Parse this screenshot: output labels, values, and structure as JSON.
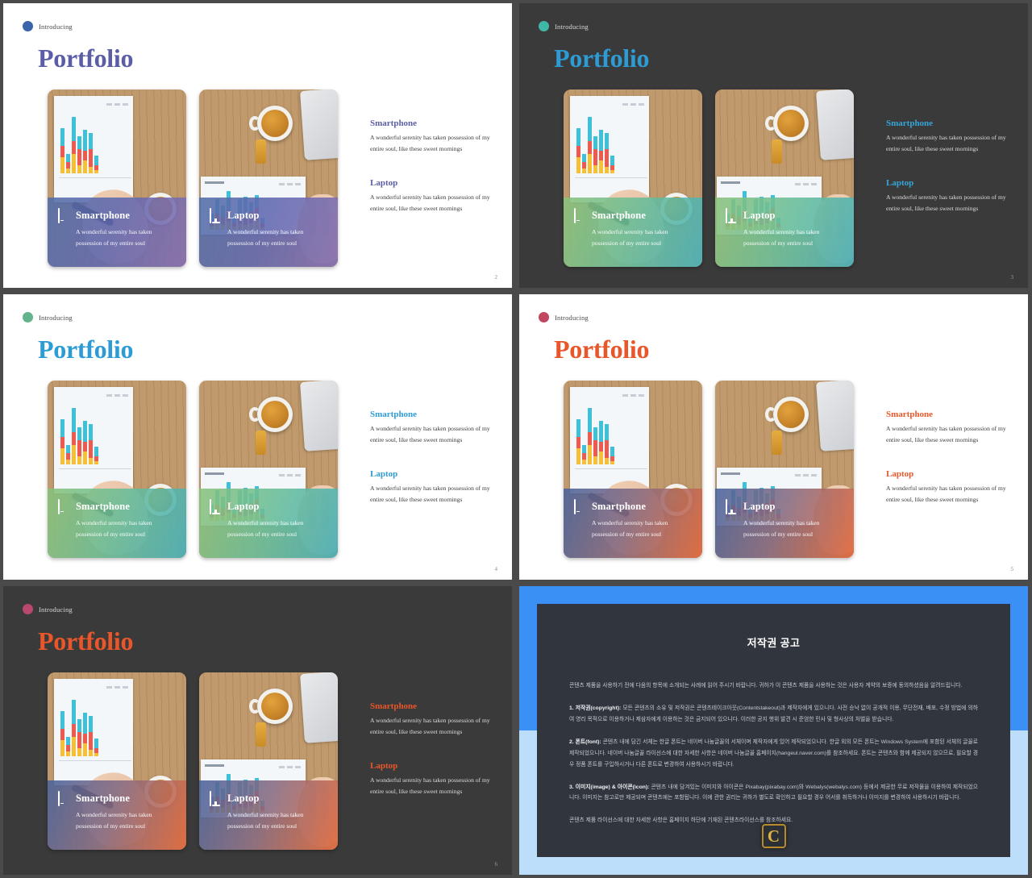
{
  "slides": [
    {
      "theme": "light",
      "dot_color": "#3c64ab",
      "eyebrow": "Introducing",
      "title": "Portfolio",
      "title_color": "#5b5ea6",
      "accent": "#5b5ea6",
      "overlay": "linear-gradient(110deg, rgba(82,110,168,0.88) 0%, rgba(96,104,176,0.88) 45%, rgba(132,110,176,0.88) 100%)",
      "cards": [
        {
          "icon": "phone-icon",
          "title": "Smartphone",
          "body": "A wonderful serenity has taken possession of my entire soul"
        },
        {
          "icon": "monitor-icon",
          "title": "Laptop",
          "body": "A wonderful serenity has taken possession of my entire soul"
        }
      ],
      "features": [
        {
          "heading": "Smartphone",
          "body": "A wonderful serenity has taken possession of my entire soul, like these sweet mornings"
        },
        {
          "heading": "Laptop",
          "body": "A wonderful serenity has taken possession of my entire soul, like these sweet mornings"
        }
      ],
      "page": "2"
    },
    {
      "theme": "dark",
      "dot_color": "#3fb8a8",
      "eyebrow": "Introducing",
      "title": "Portfolio",
      "title_color": "#2d9cd4",
      "accent": "#35a6da",
      "overlay": "linear-gradient(110deg, rgba(139,193,122,0.88) 0%, rgba(107,190,150,0.88) 45%, rgba(70,176,186,0.88) 100%)",
      "cards": [
        {
          "icon": "phone-icon",
          "title": "Smartphone",
          "body": "A wonderful serenity has taken possession of my entire soul"
        },
        {
          "icon": "monitor-icon",
          "title": "Laptop",
          "body": "A wonderful serenity has taken possession of my entire soul"
        }
      ],
      "features": [
        {
          "heading": "Smartphone",
          "body": "A wonderful serenity has taken possession of my entire soul, like these sweet mornings"
        },
        {
          "heading": "Laptop",
          "body": "A wonderful serenity has taken possession of my entire soul, like these sweet mornings"
        }
      ],
      "page": "3"
    },
    {
      "theme": "light",
      "dot_color": "#63b48c",
      "eyebrow": "Introducing",
      "title": "Portfolio",
      "title_color": "#2d9cd4",
      "accent": "#2d9cd4",
      "overlay": "linear-gradient(110deg, rgba(139,193,122,0.88) 0%, rgba(107,190,150,0.88) 45%, rgba(70,176,186,0.88) 100%)",
      "cards": [
        {
          "icon": "phone-icon",
          "title": "Smartphone",
          "body": "A wonderful serenity has taken possession of my entire soul"
        },
        {
          "icon": "monitor-icon",
          "title": "Laptop",
          "body": "A wonderful serenity has taken possession of my entire soul"
        }
      ],
      "features": [
        {
          "heading": "Smartphone",
          "body": "A wonderful serenity has taken possession of my entire soul, like these sweet mornings"
        },
        {
          "heading": "Laptop",
          "body": "A wonderful serenity has taken possession of my entire soul, like these sweet mornings"
        }
      ],
      "page": "4"
    },
    {
      "theme": "light",
      "dot_color": "#c1465f",
      "eyebrow": "Introducing",
      "title": "Portfolio",
      "title_color": "#e8562a",
      "accent": "#e8562a",
      "overlay": "linear-gradient(110deg, rgba(72,98,156,0.88) 0%, rgba(132,106,130,0.88) 45%, rgba(226,104,60,0.88) 100%)",
      "cards": [
        {
          "icon": "phone-icon",
          "title": "Smartphone",
          "body": "A wonderful serenity has taken possession of my entire soul"
        },
        {
          "icon": "monitor-icon",
          "title": "Laptop",
          "body": "A wonderful serenity has taken possession of my entire soul"
        }
      ],
      "features": [
        {
          "heading": "Smartphone",
          "body": "A wonderful serenity has taken possession of my entire soul, like these sweet mornings"
        },
        {
          "heading": "Laptop",
          "body": "A wonderful serenity has taken possession of my entire soul, like these sweet mornings"
        }
      ],
      "page": "5"
    },
    {
      "theme": "dark",
      "dot_color": "#b8486e",
      "eyebrow": "Introducing",
      "title": "Portfolio",
      "title_color": "#e8562a",
      "accent": "#e8562a",
      "overlay": "linear-gradient(110deg, rgba(72,98,156,0.88) 0%, rgba(132,106,130,0.88) 45%, rgba(226,104,60,0.88) 100%)",
      "cards": [
        {
          "icon": "phone-icon",
          "title": "Smartphone",
          "body": "A wonderful serenity has taken possession of my entire soul"
        },
        {
          "icon": "monitor-icon",
          "title": "Laptop",
          "body": "A wonderful serenity has taken possession of my entire soul"
        }
      ],
      "features": [
        {
          "heading": "Smartphone",
          "body": "A wonderful serenity has taken possession of my entire soul, like these sweet mornings"
        },
        {
          "heading": "Laptop",
          "body": "A wonderful serenity has taken possession of my entire soul, like these sweet mornings"
        }
      ],
      "page": "6"
    }
  ],
  "copyright_panel": {
    "title": "저작권 공고",
    "logo_letter": "C",
    "intro": "콘텐츠 제품을 사용하기 전에 다음의 항목에 소개되는 사례에 읽어 주시기 바랍니다. 귀하가 이 콘텐츠 제품을 사용하는 것은 사용자 계약의 보증에 동의하셨음을 알려드립니다.",
    "item1_label": "1. 저작권(copyright):",
    "item1": " 모든 콘텐츠의 소유 및 저작권은 콘텐츠테이크아웃(Contentstakeout)과 제작자에게 있으니다. 사전 승낙 없이 공개적 이용, 무단전재, 배포, 수정 방법에 의하여 영리 목적으로 이용하거나 제삼자에게 이용하는 것은 금지되어 있으니다. 이러한 공지 행위 발견 시 준엄한 민사 및 형사상의 처벌을 받습니다.",
    "item2_label": "2. 폰트(font):",
    "item2": " 콘텐츠 내에 담긴 서체는 한글 폰트는 네이버 나눔글꼴의 서체이며 제작자에게 있어 제작되었으니다. 한글 외의 모든 폰트는 Windows System에 포함된 서체의 글꼴로 제작되었으니다. 네이버 나눔글꼴 라이선스에 대한 자세한 사항은 네이버 나눔글꼴 홈페이지(hangeul.naver.com)를 참조하세요. 폰트는 콘텐츠와 함께 제공되지 않으므로, 필요할 경우 정품 폰트를 구입하시거나 다른 폰트로 변경하여 사용하시기 바랍니다.",
    "item3_label": "3. 이미지(image) & 아이콘(icon):",
    "item3": " 콘텐츠 내에 담겨있는 이미지와 아이콘은 Pixabay(pixabay.com)와 Webalys(webalys.com) 등에서 제공한 무료 저작물을 이용하여 제작되었으니다. 이미지는 참고로만 제공되며 콘텐츠에는 포함됩니다. 이에 관한 권리는 귀하가 별도로 확인하고 필요할 경우 어서를 취득하거나 이미지를 변경하여 사용하시기 바랍니다.",
    "outro": "콘텐츠 제품 라이선스에 대한 자세한 사항은 홈페이지 하단에 기재된 콘텐츠라이선스를 참조하세요."
  }
}
